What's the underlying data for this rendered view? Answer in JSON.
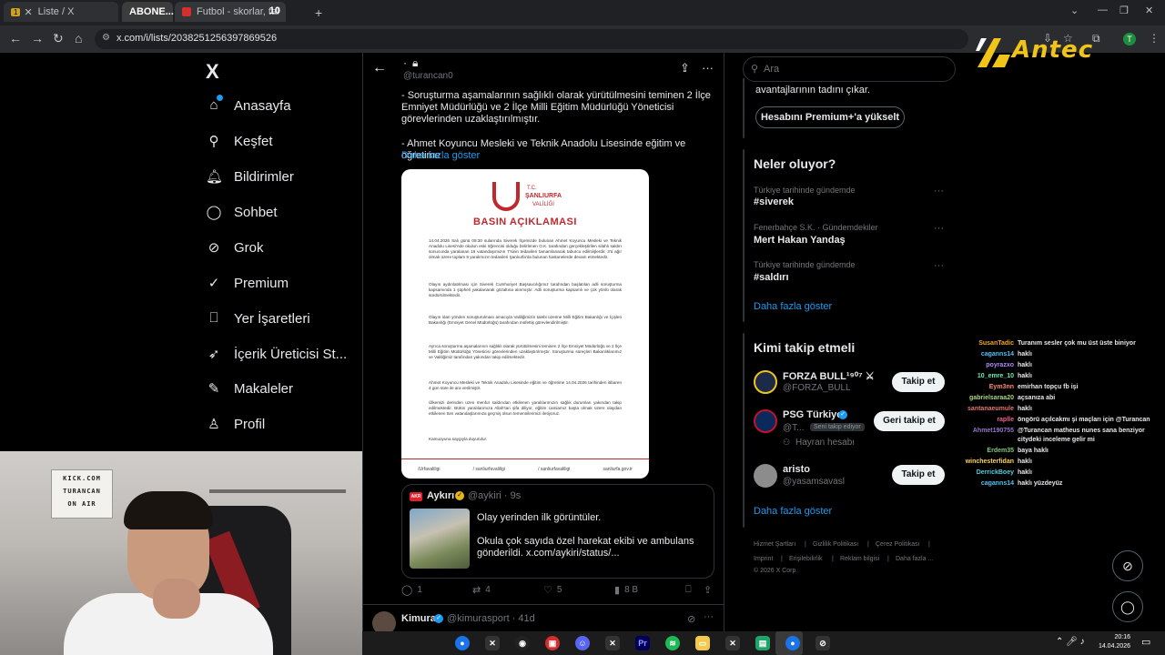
{
  "browser": {
    "tabs": [
      {
        "label": "Liste / X",
        "badge": "1"
      },
      {
        "label": "ABONE..."
      },
      {
        "label": "Futbol - skorlar, takvim & c",
        "badge": "10"
      }
    ],
    "url": "x.com/i/lists/2038251256397869526"
  },
  "overlay": {
    "brand": "Antec"
  },
  "nav": {
    "logo": "X",
    "items": [
      {
        "label": "Anasayfa",
        "icon": "home-icon"
      },
      {
        "label": "Keşfet",
        "icon": "search-icon"
      },
      {
        "label": "Bildirimler",
        "icon": "bell-icon"
      },
      {
        "label": "Sohbet",
        "icon": "chat-icon"
      },
      {
        "label": "Grok",
        "icon": "grok-icon"
      },
      {
        "label": "Premium",
        "icon": "premium-icon"
      },
      {
        "label": "Yer İşaretleri",
        "icon": "bookmark-icon"
      },
      {
        "label": "İçerik Üreticisi St...",
        "icon": "rocket-icon"
      },
      {
        "label": "Makaleler",
        "icon": "article-icon"
      },
      {
        "label": "Profil",
        "icon": "person-icon"
      }
    ]
  },
  "header": {
    "name_dot": "·",
    "handle": "@turancan0"
  },
  "post": {
    "para1": "- Soruşturma aşamalarının sağlıklı olarak yürütülmesini teminen 2 İlçe Emniyet Müdürlüğü ve 2 İlçe Milli Eğitim Müdürlüğü Yöneticisi görevlerinden uzaklaştırılmıştır.",
    "para2": "- Ahmet Koyuncu Mesleki ve Teknik Anadolu Lisesinde eğitim ve öğretime",
    "show_more": "Daha fazla göster",
    "doc": {
      "tc": "T.C.",
      "city": "ŞANLIURFA",
      "office": "VALİLİĞİ",
      "title": "BASIN AÇIKLAMASI",
      "paragraphs": [
        "14.04.2026 Salı günü 09:30 sularında Siverek İlçemizde bulunan Ahmet Koyuncu Mesleki ve Teknik Anadolu Lisesi'nde okulun eski öğrencisi olduğu belirlenen O.K. tarafından gerçekleştirilen silahlı saldırı sonucunda yaralanan 16 vatandaşımızın 7'sinin tedavileri tamamlanarak taburcu edilmişlerdir. 3'ü ağır olmak üzere toplam 9 yaralımızın tedavileri Şanlıurfa'da bulunan hastanelerde devam etmektedir.",
        "Olayın aydınlatılması için Siverek Cumhuriyet Başsavcılığımız tarafından başlatılan adli soruşturma kapsamında 1 şüpheli yakalanarak gözaltına alınmıştır. Adli soruşturma kapsamlı ve çok yönlü olarak sürdürülmektedir.",
        "Olayın idari yönden soruşturulması amacıyla Valiliğimizin talebi üzerine Milli Eğitim Bakanlığı ve İçişleri Bakanlığı (Emniyet Genel Müdürlüğü) tarafından müfettiş görevlendirilmiştir.",
        "Ayrıca soruşturma aşamalarının sağlıklı olarak yürütülmesini teminen 2 İlçe Emniyet Müdürlüğü ve 2 İlçe Milli Eğitim Müdürlüğü Yöneticisi görevlerinden uzaklaştırılmıştır. Soruşturma süreçleri Bakanlıklarımız ve Valiliğimiz tarafından yakından takip edilmektedir.",
        "Ahmet Koyuncu Mesleki ve Teknik Anadolu Lisesinde eğitim ve öğretime 14.04.2026 tarihinden itibaren 4 gün süre ile ara verilmiştir.",
        "Ülkemizi derinden üzen menfur saldırıdan etkilenen yaralılarımızın sağlık durumları yakından takip edilmektedir. Bütün yaralılarımıza Allah'tan şifa diliyor, eğitim camiamız başta olmak üzere olaydan etkilenen tüm vatandaşlarımıza geçmiş olsun temennilerimizi iletiyoruz.",
        "Kamuoyuna saygıyla duyurulur."
      ],
      "footer": [
        "/Urfavaliligi",
        "/ sanliurfavaliligi",
        "/ sanliurfavaliligi",
        "sanliurfa.gov.tr"
      ]
    },
    "quote": {
      "name": "Aykırı",
      "handle": "@aykiri · 9s",
      "text1": "Olay yerinden ilk görüntüler.",
      "text2": "Okula çok sayıda özel harekat ekibi ve ambulans gönderildi.  x.com/aykiri/status/..."
    },
    "stats": {
      "replies": "1",
      "reposts": "4",
      "likes": "5",
      "views": "8 B"
    }
  },
  "next_post": {
    "name": "Kimura",
    "handle": "@kimurasport · 41d"
  },
  "right": {
    "search_placeholder": "Ara",
    "premium_text": "avantajlarının tadını çıkar.",
    "premium_button": "Hesabını Premium+'a yükselt",
    "trends_title": "Neler oluyor?",
    "trends": [
      {
        "context": "Türkiye tarihinde gündemde",
        "name": "#siverek"
      },
      {
        "context": "Fenerbahçe S.K. · Gündemdekiler",
        "name": "Mert Hakan Yandaş"
      },
      {
        "context": "Türkiye tarihinde gündemde",
        "name": "#saldırı"
      }
    ],
    "trends_more": "Daha fazla göster",
    "wtf_title": "Kimi takip etmeli",
    "wtf": [
      {
        "name": "FORZA BULL¹⁹⁰⁷ ⚔",
        "handle": "@FORZA_BULL",
        "button": "Takip et"
      },
      {
        "name": "PSG Türkiye",
        "handle": "@T...",
        "button": "Geri takip et",
        "badge": "Seni takip ediyor",
        "extra": "Hayran hesabı"
      },
      {
        "name": "aristo",
        "handle": "@yasamsavasl",
        "button": "Takip et"
      }
    ],
    "wtf_more": "Daha fazla göster",
    "footer": [
      "Hizmet Şartları",
      "|",
      "Gizlilik Politikası",
      "|",
      "Çerez Politikası",
      "|",
      "Imprint",
      "|",
      "Erişilebilirlik",
      "|",
      "Reklam bilgisi",
      "|",
      "Daha fazla ...",
      "© 2026 X Corp."
    ]
  },
  "chat": [
    {
      "user": "SusanTadic",
      "color": "#f5a623",
      "msg": "Turanım sesler çok mu üst üste biniyor"
    },
    {
      "user": "caganns14",
      "color": "#4fc3f7",
      "msg": "haklı"
    },
    {
      "user": "poyrazxo",
      "color": "#b388ff",
      "msg": "haklı"
    },
    {
      "user": "10_emre_10",
      "color": "#69f0ae",
      "msg": "haklı"
    },
    {
      "user": "Eym3nn",
      "color": "#ff8a65",
      "msg": "emirhan topçu fb işi"
    },
    {
      "user": "gabrielsaraa20",
      "color": "#aed581",
      "msg": "açsanıza abi"
    },
    {
      "user": "santanaeumule",
      "color": "#e57373",
      "msg": "haklı"
    },
    {
      "user": "raplle",
      "color": "#f06292",
      "msg": "öngörü açılcakmı şi maçları için @Turancan"
    },
    {
      "user": "Ahmet190755",
      "color": "#9575cd",
      "msg": "@Turancan matheus nunes sana benziyor citydeki inceleme gelir mi"
    },
    {
      "user": "Erdem35",
      "color": "#81c784",
      "msg": "baya haklı"
    },
    {
      "user": "winchesterfidan",
      "color": "#ffd54f",
      "msg": "haklı"
    },
    {
      "user": "DerrickBoey",
      "color": "#4dd0e1",
      "msg": "haklı"
    },
    {
      "user": "caganns14",
      "color": "#4fc3f7",
      "msg": "haklı yüzdeyüz"
    }
  ],
  "webcam": {
    "frame_lines": [
      "KICK.COM",
      "TURANCAN",
      "ON AIR"
    ]
  },
  "taskbar": {
    "time": "20:16",
    "date": "14.04.2026"
  }
}
